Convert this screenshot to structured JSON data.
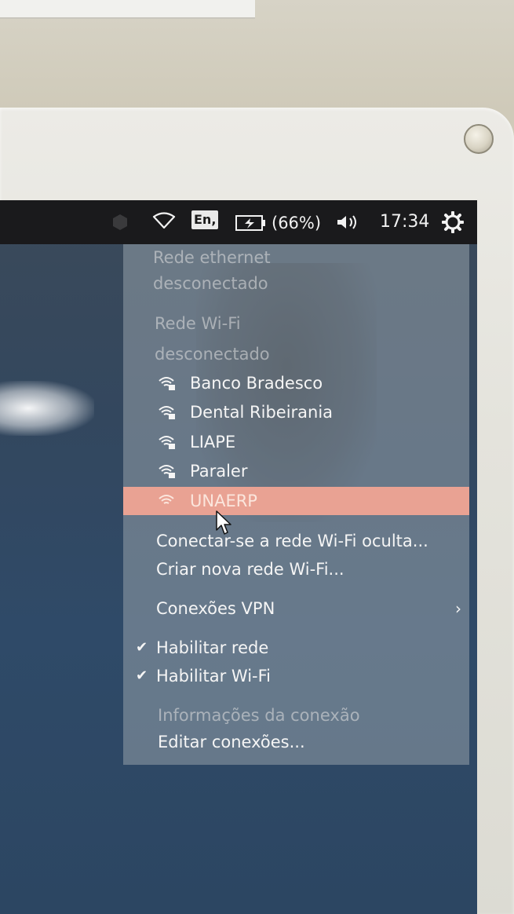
{
  "panel": {
    "keyboard_layout": "En,",
    "battery_text": "(66%)",
    "clock": "17:34",
    "icons": [
      "app-indicator-icon",
      "wifi-icon",
      "keyboard-layout-icon",
      "battery-icon",
      "volume-icon",
      "gear-icon"
    ]
  },
  "menu": {
    "ethernet_header": "Rede ethernet",
    "ethernet_status": "desconectado",
    "wifi_header": "Rede Wi-Fi",
    "wifi_status": "desconectado",
    "networks": [
      {
        "name": "Banco Bradesco"
      },
      {
        "name": "Dental Ribeirania"
      },
      {
        "name": "LIAPE"
      },
      {
        "name": "Paraler"
      },
      {
        "name": "UNAERP"
      }
    ],
    "connect_hidden": "Conectar-se a rede Wi-Fi oculta...",
    "create_new": "Criar nova rede Wi-Fi...",
    "vpn": "Conexões VPN",
    "enable_network": "Habilitar rede",
    "enable_wifi": "Habilitar Wi-Fi",
    "connection_info": "Informações da conexão",
    "edit_connections": "Editar conexões..."
  },
  "colors": {
    "panel": "#1a1a1c",
    "highlight": "#e9a293",
    "menu": "#9aa3ab"
  }
}
